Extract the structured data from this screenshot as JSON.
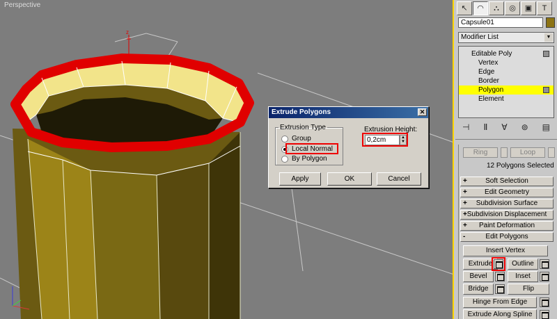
{
  "viewport": {
    "label": "Perspective"
  },
  "dialog": {
    "title": "Extrude Polygons",
    "close": "✕",
    "group_label": "Extrusion Type",
    "options": [
      "Group",
      "Local Normal",
      "By Polygon"
    ],
    "selected": "Local Normal",
    "height_label": "Extrusion Height:",
    "height_value": "0,2cm",
    "buttons": {
      "apply": "Apply",
      "ok": "OK",
      "cancel": "Cancel"
    }
  },
  "panel": {
    "tabs": [
      "↖",
      "◠",
      "⛬",
      "◎",
      "▣",
      "T"
    ],
    "object_name": "Capsule01",
    "modifier_list": "Modifier List",
    "stack": {
      "root": "Editable Poly",
      "items": [
        "Vertex",
        "Edge",
        "Border",
        "Polygon",
        "Element"
      ],
      "selected": "Polygon"
    },
    "stack_tools": [
      "⊣",
      "Ⅱ",
      "∀",
      "⊚",
      "▤"
    ],
    "ring": "Ring",
    "loop": "Loop",
    "selection_count": "12 Polygons Selected",
    "rollouts": [
      {
        "sign": "+",
        "label": "Soft Selection"
      },
      {
        "sign": "+",
        "label": "Edit Geometry"
      },
      {
        "sign": "+",
        "label": "Subdivision Surface"
      },
      {
        "sign": "+",
        "label": "Subdivision Displacement"
      },
      {
        "sign": "+",
        "label": "Paint Deformation"
      },
      {
        "sign": "-",
        "label": "Edit Polygons"
      }
    ],
    "edit_polygons": {
      "insert_vertex": "Insert Vertex",
      "extrude": "Extrude",
      "outline": "Outline",
      "bevel": "Bevel",
      "inset": "Inset",
      "bridge": "Bridge",
      "flip": "Flip",
      "hinge": "Hinge From Edge",
      "extrude_spline": "Extrude Along Spline"
    }
  },
  "colors": {
    "highlight": "#ffff00",
    "selection_red": "#e00000",
    "viewport_border": "#ffd400"
  }
}
